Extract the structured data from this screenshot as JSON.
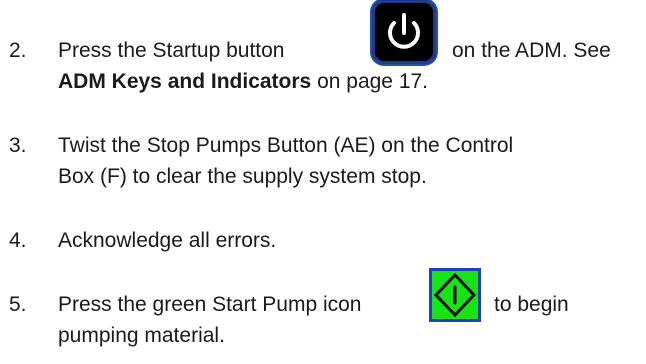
{
  "steps": [
    {
      "number": "2.",
      "part1": "Press the Startup button",
      "part2": "on the ADM. See",
      "line2_bold": "ADM Keys and Indicators",
      "line2_rest": " on page 17.",
      "icon": "power-icon"
    },
    {
      "number": "3.",
      "line1": "Twist the Stop Pumps Button (AE) on the Control",
      "line2": "Box (F) to clear the supply system stop."
    },
    {
      "number": "4.",
      "line1": "Acknowledge all errors."
    },
    {
      "number": "5.",
      "part1": "Press the green Start Pump icon",
      "part2": "to begin",
      "line2": "pumping material.",
      "icon": "start-pump-icon"
    }
  ],
  "colors": {
    "text": "#1a1a1a",
    "startup_button_bg": "#000000",
    "startup_button_border": "#2b4fb0",
    "start_icon_border": "#1f3fbf",
    "start_icon_fill": "#17e317"
  }
}
